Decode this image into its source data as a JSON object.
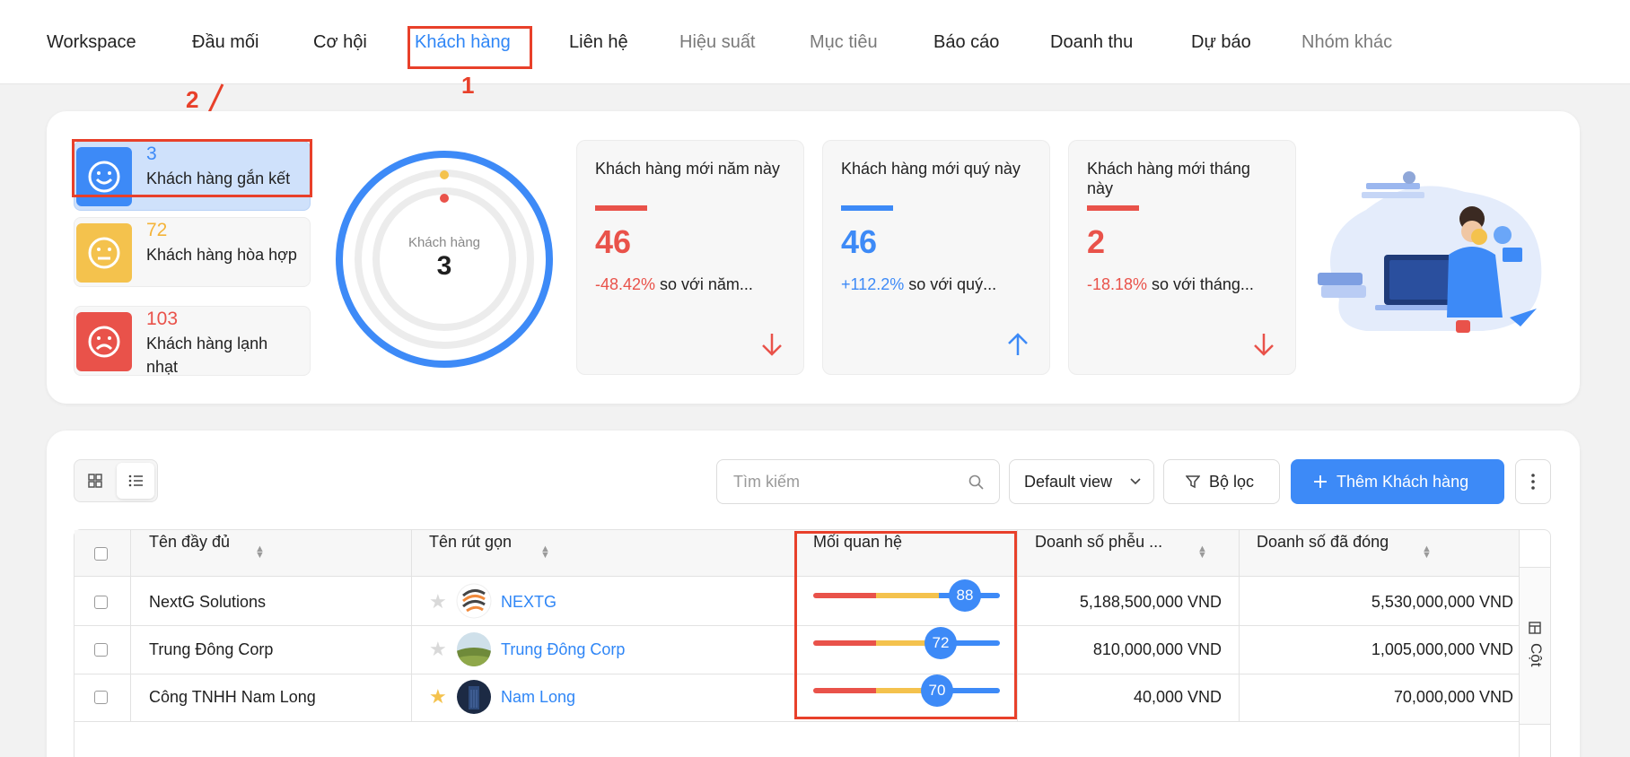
{
  "nav": {
    "items": [
      {
        "label": "Workspace",
        "state": "normal"
      },
      {
        "label": "Đầu mối",
        "state": "normal"
      },
      {
        "label": "Cơ hội",
        "state": "normal"
      },
      {
        "label": "Khách hàng",
        "state": "active"
      },
      {
        "label": "Liên hệ",
        "state": "normal"
      },
      {
        "label": "Hiệu suất",
        "state": "muted"
      },
      {
        "label": "Mục tiêu",
        "state": "muted"
      },
      {
        "label": "Báo cáo",
        "state": "normal"
      },
      {
        "label": "Doanh thu",
        "state": "normal"
      },
      {
        "label": "Dự báo",
        "state": "normal"
      },
      {
        "label": "Nhóm khác",
        "state": "muted"
      }
    ]
  },
  "annotations": {
    "one": "1",
    "two": "2"
  },
  "segments": [
    {
      "count": "3",
      "label": "Khách hàng gắn kết",
      "color": "#3d8af7",
      "icon": "smile-icon"
    },
    {
      "count": "72",
      "label": "Khách hàng hòa hợp",
      "color": "#f4c24d",
      "icon": "neutral-face-icon"
    },
    {
      "count": "103",
      "label": "Khách hàng lạnh nhạt",
      "color": "#e9524a",
      "icon": "sad-face-icon"
    }
  ],
  "ring": {
    "label": "Khách hàng",
    "value": "3"
  },
  "kpis": [
    {
      "title": "Khách hàng mới năm này",
      "value": "46",
      "change": "-48.42%",
      "suffix": " so với năm...",
      "color": "#e9524a",
      "direction": "down"
    },
    {
      "title": "Khách hàng mới quý này",
      "value": "46",
      "change": "+112.2%",
      "suffix": " so với quý...",
      "color": "#3d8af7",
      "direction": "up"
    },
    {
      "title": "Khách hàng mới tháng này",
      "value": "2",
      "change": "-18.18%",
      "suffix": " so với tháng...",
      "color": "#e9524a",
      "direction": "down"
    }
  ],
  "toolbar": {
    "search_placeholder": "Tìm kiếm",
    "view_label": "Default view",
    "filter_label": "Bộ lọc",
    "add_label": "Thêm Khách hàng"
  },
  "table": {
    "headers": {
      "fullname": "Tên đầy đủ",
      "shortname": "Tên rút gọn",
      "relation": "Mối quan hệ",
      "pipeline": "Doanh số phễu ...",
      "closed": "Doanh số đã đóng"
    },
    "columns_label": "Cột",
    "rows": [
      {
        "fullname": "NextG Solutions",
        "shortname": "NEXTG",
        "starred": false,
        "relation": 88,
        "pipeline": "5,188,500,000 VND",
        "closed": "5,530,000,000 VND"
      },
      {
        "fullname": "Trung Đông Corp",
        "shortname": "Trung Đông Corp",
        "starred": false,
        "relation": 72,
        "pipeline": "810,000,000 VND",
        "closed": "1,005,000,000 VND"
      },
      {
        "fullname": "Công TNHH Nam Long",
        "shortname": "Nam Long",
        "starred": true,
        "relation": 70,
        "pipeline": "40,000 VND",
        "closed": "70,000,000 VND"
      }
    ]
  }
}
